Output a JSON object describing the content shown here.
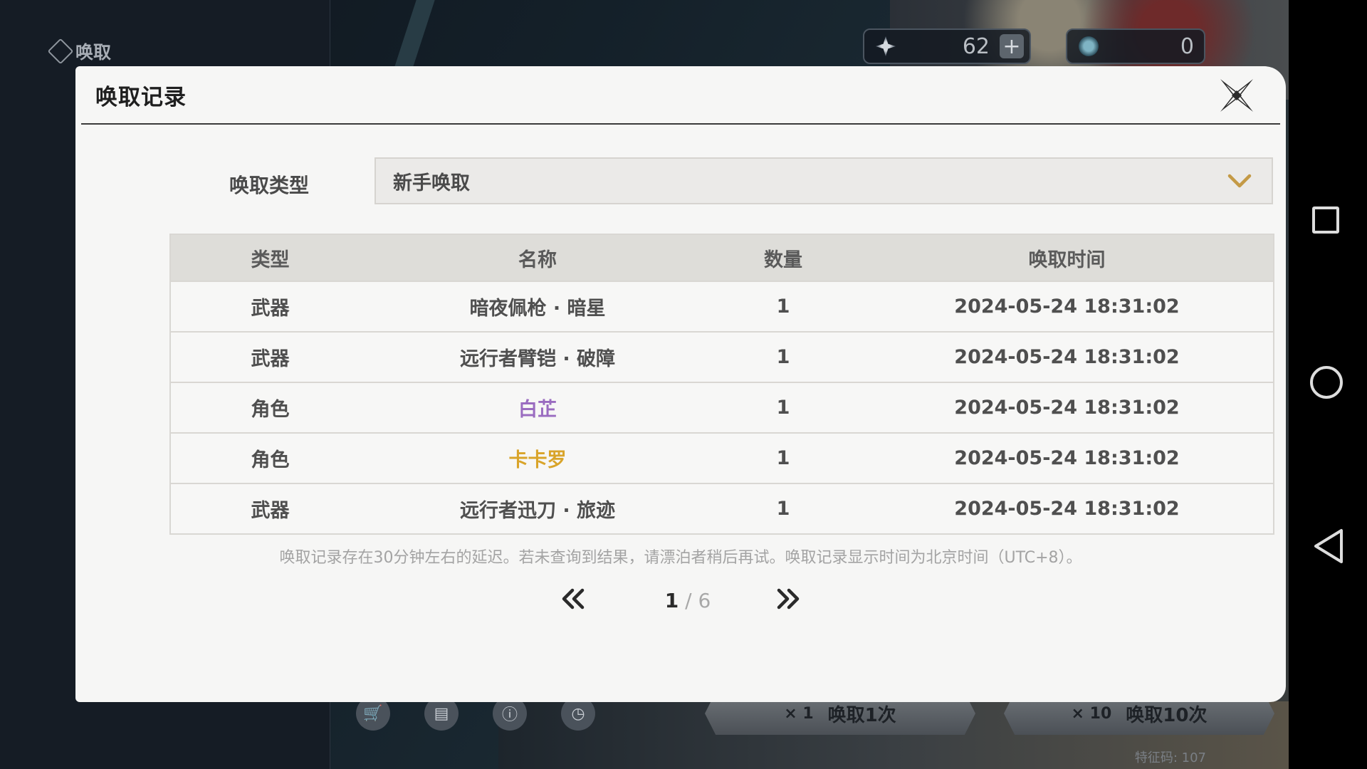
{
  "top_bar": {
    "label": "唤取",
    "currency1_value": "62",
    "currency1_plus": "+",
    "currency2_value": "0"
  },
  "bottom_bar": {
    "pull_single_cost": "× 1",
    "pull_single_label": "唤取1次",
    "pull_ten_cost": "× 10",
    "pull_ten_label": "唤取10次",
    "watermark": "特征码: 107"
  },
  "modal": {
    "title": "唤取记录",
    "type_label": "唤取类型",
    "type_selected": "新手唤取",
    "columns": [
      "类型",
      "名称",
      "数量",
      "唤取时间"
    ],
    "rows": [
      {
        "type": "武器",
        "name": "暗夜佩枪 · 暗星",
        "qty": "1",
        "time": "2024-05-24 18:31:02",
        "color": "#4f4f4f"
      },
      {
        "type": "武器",
        "name": "远行者臂铠 · 破障",
        "qty": "1",
        "time": "2024-05-24 18:31:02",
        "color": "#4f4f4f"
      },
      {
        "type": "角色",
        "name": "白芷",
        "qty": "1",
        "time": "2024-05-24 18:31:02",
        "color": "#9a6cc0"
      },
      {
        "type": "角色",
        "name": "卡卡罗",
        "qty": "1",
        "time": "2024-05-24 18:31:02",
        "color": "#d9a42a"
      },
      {
        "type": "武器",
        "name": "远行者迅刀 · 旅迹",
        "qty": "1",
        "time": "2024-05-24 18:31:02",
        "color": "#4f4f4f"
      }
    ],
    "note": "唤取记录存在30分钟左右的延迟。若未查询到结果，请漂泊者稍后再试。唤取记录显示时间为北京时间（UTC+8）。",
    "pager": {
      "current": "1",
      "separator": " / ",
      "total": "6"
    }
  },
  "icons": {
    "close": "close-x-icon",
    "prev": "double-chevron-left-icon",
    "next": "double-chevron-right-icon",
    "dropdown": "chevron-down-icon"
  },
  "colors": {
    "accent_gold": "#c49a46",
    "five_star": "#d9a42a",
    "four_star": "#9a6cc0"
  }
}
